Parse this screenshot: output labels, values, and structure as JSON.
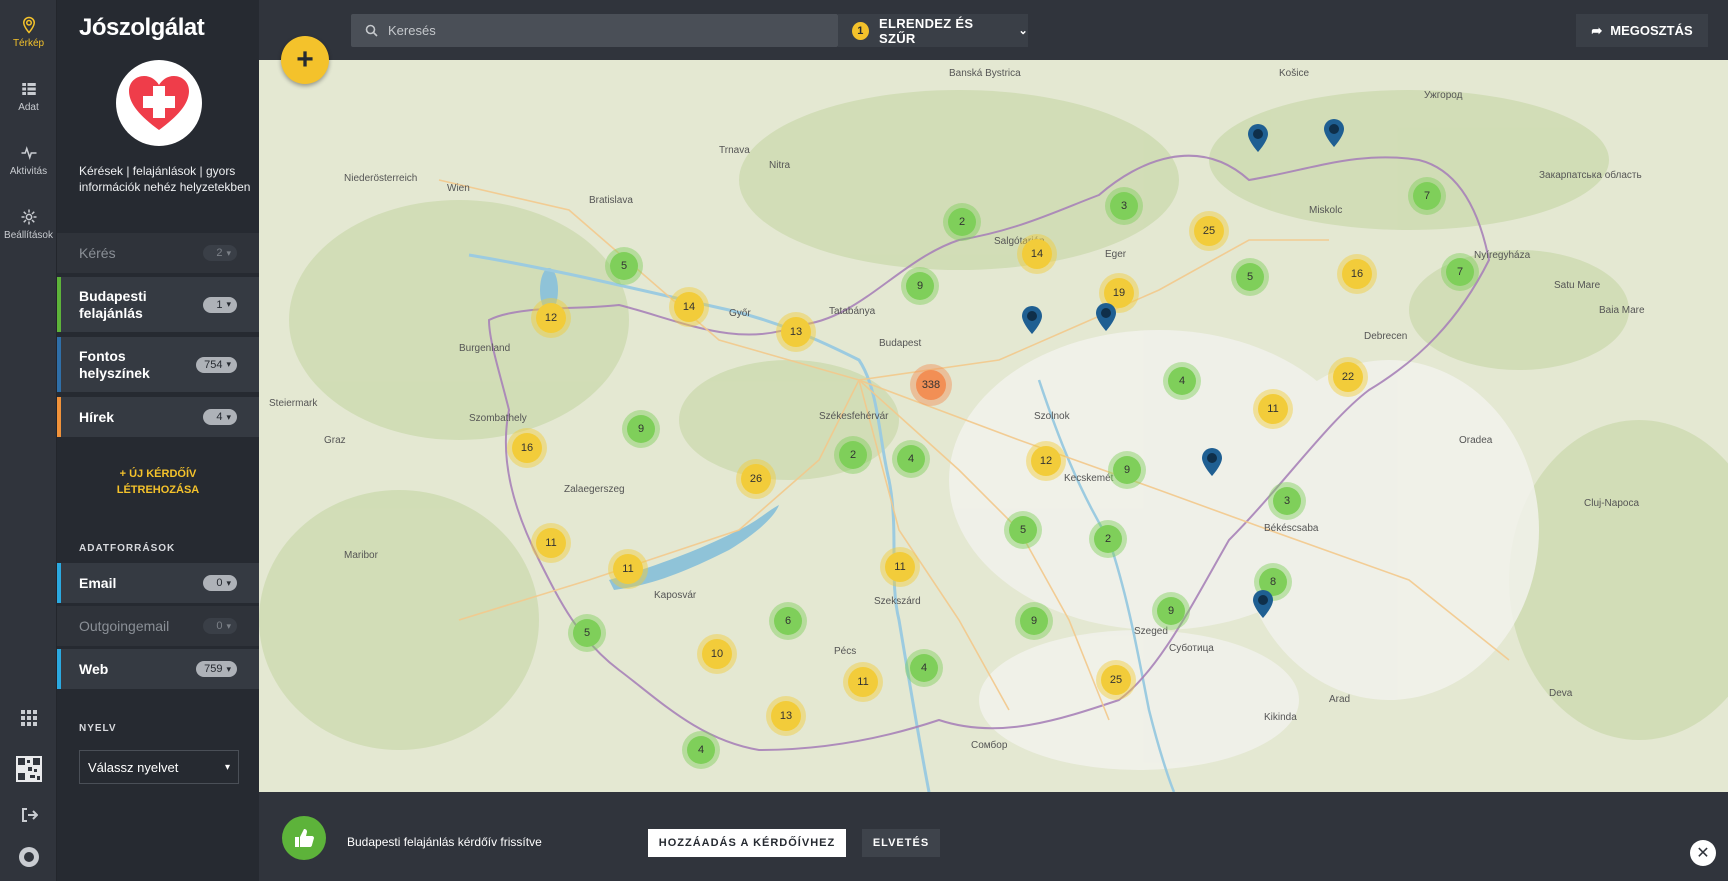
{
  "rail": {
    "items": [
      {
        "label": "Térkép",
        "icon": "map-pin-icon",
        "active": true
      },
      {
        "label": "Adat",
        "icon": "list-icon"
      },
      {
        "label": "Aktivitás",
        "icon": "pulse-icon"
      },
      {
        "label": "Beállítások",
        "icon": "gear-icon"
      }
    ]
  },
  "sidebar": {
    "title": "Jószolgálat",
    "description": "Kérések | felajánlások | gyors információk nehéz helyzetekben",
    "layers": [
      {
        "label": "Kérés",
        "count": "2",
        "color": "",
        "dim": true
      },
      {
        "label": "Budapesti felajánlás",
        "count": "1",
        "color": "#5db33a"
      },
      {
        "label": "Fontos helyszínek",
        "count": "754",
        "color": "#2f6fa8"
      },
      {
        "label": "Hírek",
        "count": "4",
        "color": "#f0923a"
      }
    ],
    "new_survey_label": "ÚJ KÉRDŐÍV LÉTREHOZÁSA",
    "datasources_heading": "ADATFORRÁSOK",
    "datasources": [
      {
        "label": "Email",
        "count": "0",
        "color": "#2ba9e0"
      },
      {
        "label": "Outgoingemail",
        "count": "0",
        "color": "",
        "dim": true
      },
      {
        "label": "Web",
        "count": "759",
        "color": "#2ba9e0"
      }
    ],
    "language_heading": "NYELV",
    "language_placeholder": "Válassz nyelvet"
  },
  "topbar": {
    "search_placeholder": "Keresés",
    "filter_badge": "1",
    "filter_label": "ELRENDEZ ÉS SZŰR",
    "share_label": "MEGOSZTÁS",
    "add_label": "+"
  },
  "map": {
    "places": [
      "Banská Bystrica",
      "Košice",
      "Ужгород",
      "Trnava",
      "Nitra",
      "Niederösterreich",
      "Wien",
      "Bratislava",
      "Salgótarján",
      "Eger",
      "Miskolc",
      "Nyíregyháza",
      "Закарпатська область",
      "Satu Mare",
      "Baia Mare",
      "Tatabánya",
      "Budapest",
      "Debrecen",
      "Burgenland",
      "Szombathely",
      "Steiermark",
      "Székesfehérvár",
      "Szolnok",
      "Oradea",
      "Graz",
      "Kecskemét",
      "Zalaegerszeg",
      "Békéscsaba",
      "Cluj-Napoca",
      "Maribor",
      "Kaposvár",
      "Szekszárd",
      "Szeged",
      "Arad",
      "Pécs",
      "Суботица",
      "Deva",
      "Kikinda",
      "Сомбор",
      "Győr"
    ],
    "clusters": [
      {
        "n": "5",
        "c": "g"
      },
      {
        "n": "12",
        "c": "y"
      },
      {
        "n": "14",
        "c": "y"
      },
      {
        "n": "13",
        "c": "y"
      },
      {
        "n": "9",
        "c": "g"
      },
      {
        "n": "2",
        "c": "g"
      },
      {
        "n": "14",
        "c": "y"
      },
      {
        "n": "3",
        "c": "g"
      },
      {
        "n": "25",
        "c": "y"
      },
      {
        "n": "19",
        "c": "y"
      },
      {
        "n": "5",
        "c": "g"
      },
      {
        "n": "16",
        "c": "y"
      },
      {
        "n": "7",
        "c": "g"
      },
      {
        "n": "7",
        "c": "g"
      },
      {
        "n": "22",
        "c": "y"
      },
      {
        "n": "4",
        "c": "g"
      },
      {
        "n": "11",
        "c": "y"
      },
      {
        "n": "338",
        "c": "o"
      },
      {
        "n": "9",
        "c": "g"
      },
      {
        "n": "16",
        "c": "y"
      },
      {
        "n": "2",
        "c": "g"
      },
      {
        "n": "4",
        "c": "g"
      },
      {
        "n": "12",
        "c": "y"
      },
      {
        "n": "9",
        "c": "g"
      },
      {
        "n": "26",
        "c": "y"
      },
      {
        "n": "3",
        "c": "g"
      },
      {
        "n": "11",
        "c": "y"
      },
      {
        "n": "5",
        "c": "g"
      },
      {
        "n": "2",
        "c": "g"
      },
      {
        "n": "11",
        "c": "y"
      },
      {
        "n": "11",
        "c": "y"
      },
      {
        "n": "8",
        "c": "g"
      },
      {
        "n": "6",
        "c": "g"
      },
      {
        "n": "9",
        "c": "g"
      },
      {
        "n": "9",
        "c": "g"
      },
      {
        "n": "5",
        "c": "g"
      },
      {
        "n": "10",
        "c": "y"
      },
      {
        "n": "4",
        "c": "g"
      },
      {
        "n": "11",
        "c": "y"
      },
      {
        "n": "25",
        "c": "y"
      },
      {
        "n": "13",
        "c": "y"
      },
      {
        "n": "4",
        "c": "g"
      }
    ]
  },
  "notification": {
    "text": "Budapesti felajánlás kérdőív frissítve",
    "add_label": "HOZZÁADÁS A KÉRDŐÍVHEZ",
    "dismiss_label": "ELVETÉS"
  }
}
